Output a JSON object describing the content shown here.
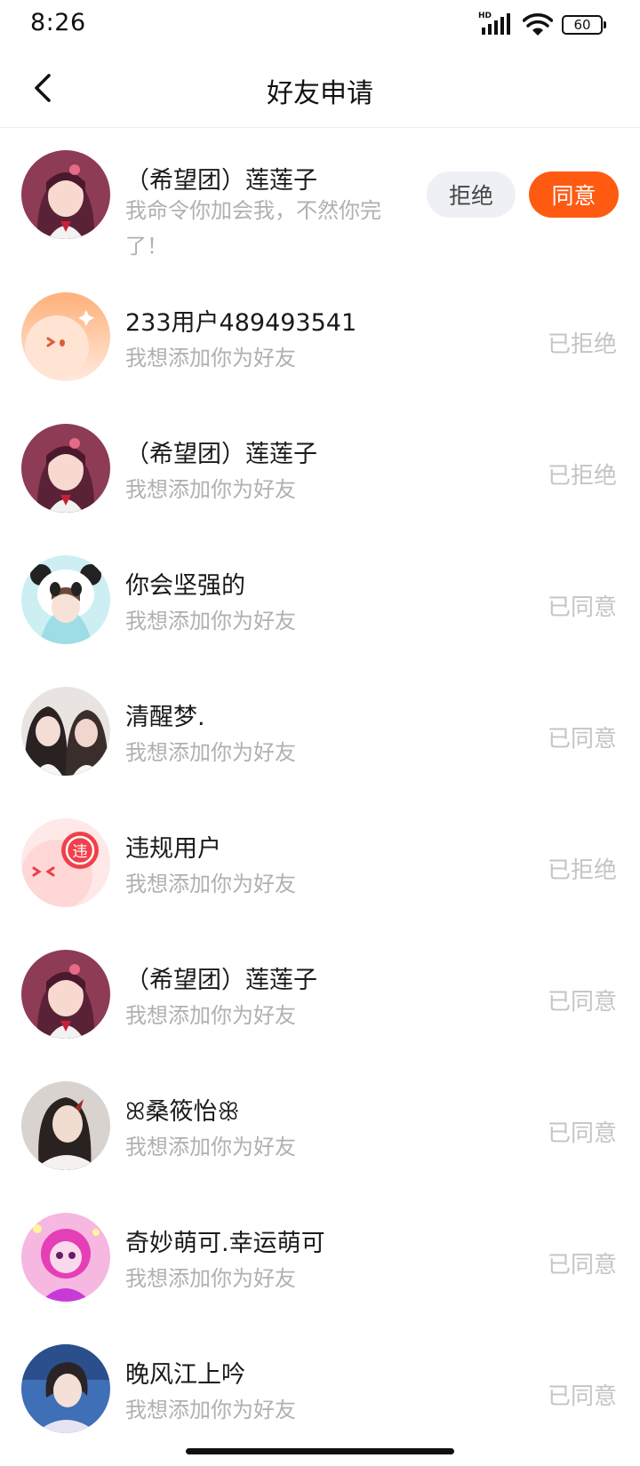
{
  "status_bar": {
    "time": "8:26",
    "hd_label": "HD",
    "battery": "60"
  },
  "nav": {
    "title": "好友申请"
  },
  "requests": [
    {
      "name": "（希望团）莲莲子",
      "message": "我命令你加会我，不然你完了！",
      "reject_label": "拒绝",
      "accept_label": "同意"
    },
    {
      "name": "233用户489493541",
      "message": "我想添加你为好友",
      "status": "已拒绝"
    },
    {
      "name": "（希望团）莲莲子",
      "message": "我想添加你为好友",
      "status": "已拒绝"
    },
    {
      "name": "你会坚强的",
      "message": "我想添加你为好友",
      "status": "已同意"
    },
    {
      "name": "清醒梦.",
      "message": "我想添加你为好友",
      "status": "已同意"
    },
    {
      "name": "违规用户",
      "message": "我想添加你为好友",
      "status": "已拒绝",
      "avatar_badge": "违"
    },
    {
      "name": "（希望团）莲莲子",
      "message": "我想添加你为好友",
      "status": "已同意"
    },
    {
      "name": "ꕤ桑筱怡ꕥ",
      "message": "我想添加你为好友",
      "status": "已同意"
    },
    {
      "name": "奇妙萌可.幸运萌可",
      "message": "我想添加你为好友",
      "status": "已同意"
    },
    {
      "name": "晚风江上吟",
      "message": "我想添加你为好友",
      "status": "已同意"
    }
  ],
  "colors": {
    "accent": "#ff5a12",
    "reject_bg": "#eef0f5",
    "muted_text": "#b0b0b0",
    "status_text": "#c4c4c4"
  }
}
